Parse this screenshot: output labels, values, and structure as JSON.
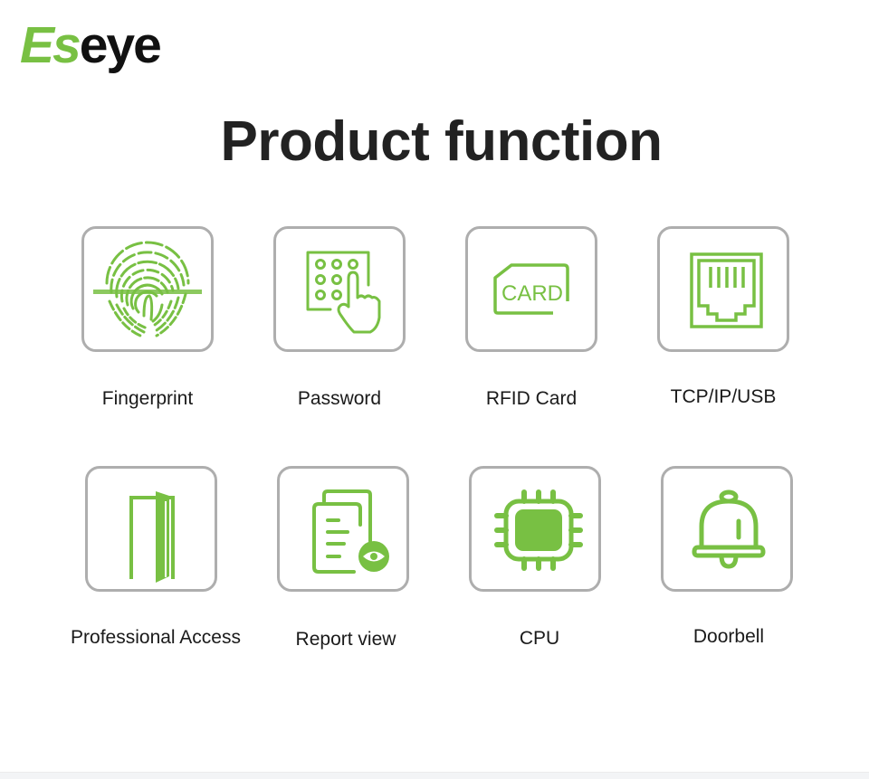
{
  "brand": {
    "logo_part1": "Es",
    "logo_part2": "eye",
    "accent_color": "#78c043"
  },
  "title": "Product function",
  "features": [
    {
      "label": "Fingerprint",
      "icon": "fingerprint-icon"
    },
    {
      "label": "Password",
      "icon": "keypad-icon"
    },
    {
      "label": "RFID Card",
      "icon": "rfid-card-icon"
    },
    {
      "label": "TCP/IP/USB",
      "icon": "ethernet-port-icon"
    },
    {
      "label": "Professional Access",
      "icon": "door-icon"
    },
    {
      "label": "Report view",
      "icon": "report-view-icon"
    },
    {
      "label": "CPU",
      "icon": "cpu-chip-icon"
    },
    {
      "label": "Doorbell",
      "icon": "bell-icon"
    }
  ],
  "card_icon_text": "CARD"
}
